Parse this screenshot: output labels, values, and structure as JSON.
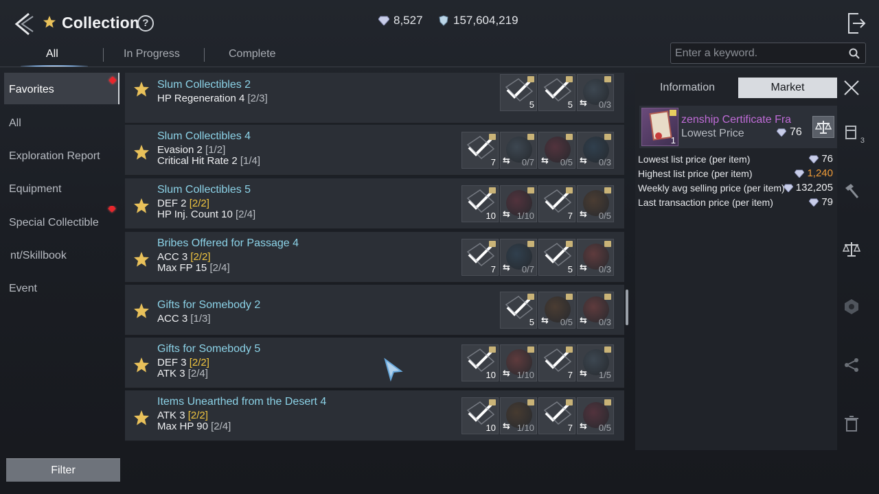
{
  "header": {
    "title": "Collection",
    "currencies": [
      {
        "icon": "diamond-icon",
        "value": "8,527"
      },
      {
        "icon": "shield-coin-icon",
        "value": "157,604,219"
      }
    ]
  },
  "tabs": [
    {
      "label": "All",
      "active": true
    },
    {
      "label": "In Progress",
      "active": false
    },
    {
      "label": "Complete",
      "active": false
    }
  ],
  "search": {
    "placeholder": "Enter a keyword."
  },
  "sidebar": {
    "items": [
      {
        "label": "Favorites",
        "active": true,
        "alert": true
      },
      {
        "label": "All",
        "active": false,
        "alert": false
      },
      {
        "label": "Exploration Report",
        "active": false,
        "alert": false
      },
      {
        "label": "Equipment",
        "active": false,
        "alert": false
      },
      {
        "label": "Special Collectible",
        "active": false,
        "alert": true
      },
      {
        "label": "nt/Skillbook",
        "active": false,
        "alert": false
      },
      {
        "label": "Event",
        "active": false,
        "alert": false
      }
    ],
    "filter_label": "Filter"
  },
  "collections": [
    {
      "name": "Slum Collectibles 2",
      "stats": [
        {
          "label": "HP Regeneration 4",
          "progress": "[2/3]",
          "complete": false
        }
      ],
      "slots": [
        {
          "type": "check",
          "qty": "5"
        },
        {
          "type": "check",
          "qty": "5"
        },
        {
          "type": "item",
          "progress": "0/3"
        }
      ]
    },
    {
      "name": "Slum Collectibles 4",
      "stats": [
        {
          "label": "Evasion 2",
          "progress": "[1/2]",
          "complete": false
        },
        {
          "label": "Critical Hit Rate 2",
          "progress": "[1/4]",
          "complete": false
        }
      ],
      "slots": [
        {
          "type": "check",
          "qty": "7"
        },
        {
          "type": "item",
          "progress": "0/7"
        },
        {
          "type": "item",
          "progress": "0/5"
        },
        {
          "type": "item",
          "progress": "0/3"
        }
      ]
    },
    {
      "name": "Slum Collectibles 5",
      "stats": [
        {
          "label": "DEF 2",
          "progress": "[2/2]",
          "complete": true
        },
        {
          "label": "HP Inj. Count 10",
          "progress": "[2/4]",
          "complete": false
        }
      ],
      "slots": [
        {
          "type": "check",
          "qty": "10"
        },
        {
          "type": "item",
          "progress": "1/10"
        },
        {
          "type": "check",
          "qty": "7"
        },
        {
          "type": "item",
          "progress": "0/5"
        }
      ]
    },
    {
      "name": "Bribes Offered for Passage 4",
      "stats": [
        {
          "label": "ACC 3",
          "progress": "[2/2]",
          "complete": true
        },
        {
          "label": "Max FP 15",
          "progress": "[2/4]",
          "complete": false
        }
      ],
      "slots": [
        {
          "type": "check",
          "qty": "7"
        },
        {
          "type": "item",
          "progress": "0/7"
        },
        {
          "type": "check",
          "qty": "5"
        },
        {
          "type": "item",
          "progress": "0/3"
        }
      ]
    },
    {
      "name": "Gifts for Somebody 2",
      "stats": [
        {
          "label": "ACC 3",
          "progress": "[1/3]",
          "complete": false
        }
      ],
      "slots": [
        {
          "type": "check",
          "qty": "5"
        },
        {
          "type": "item",
          "progress": "0/5"
        },
        {
          "type": "item",
          "progress": "0/3"
        }
      ]
    },
    {
      "name": "Gifts for Somebody 5",
      "stats": [
        {
          "label": "DEF 3",
          "progress": "[2/2]",
          "complete": true
        },
        {
          "label": "ATK 3",
          "progress": "[2/4]",
          "complete": false
        }
      ],
      "slots": [
        {
          "type": "check",
          "qty": "10"
        },
        {
          "type": "item",
          "progress": "1/10"
        },
        {
          "type": "check",
          "qty": "7"
        },
        {
          "type": "item",
          "progress": "1/5"
        }
      ]
    },
    {
      "name": "Items Unearthed from the Desert 4",
      "stats": [
        {
          "label": "ATK 3",
          "progress": "[2/2]",
          "complete": true
        },
        {
          "label": "Max HP 90",
          "progress": "[2/4]",
          "complete": false
        }
      ],
      "slots": [
        {
          "type": "check",
          "qty": "10"
        },
        {
          "type": "item",
          "progress": "1/10"
        },
        {
          "type": "check",
          "qty": "7"
        },
        {
          "type": "item",
          "progress": "0/5"
        }
      ]
    }
  ],
  "panel": {
    "tabs": [
      {
        "label": "Information",
        "active": false
      },
      {
        "label": "Market",
        "active": true
      }
    ],
    "item": {
      "name": "zenship Certificate Fra",
      "qty": "1",
      "lowest_label": "Lowest Price",
      "lowest_value": "76"
    },
    "prices": [
      {
        "label": "Lowest list price (per item)",
        "value": "76",
        "highlight": false
      },
      {
        "label": "Highest list price (per item)",
        "value": "1,240",
        "highlight": true
      },
      {
        "label": "Weekly avg selling price (per item)",
        "value": "132,205",
        "highlight": false
      },
      {
        "label": "Last transaction price (per item)",
        "value": "79",
        "highlight": false
      }
    ],
    "side_tools": [
      {
        "icon": "storage-icon",
        "badge": "3"
      },
      {
        "icon": "hammer-icon",
        "badge": ""
      },
      {
        "icon": "scale-icon",
        "badge": ""
      },
      {
        "icon": "hexagon-icon",
        "badge": ""
      },
      {
        "icon": "share-icon",
        "badge": ""
      },
      {
        "icon": "trash-icon",
        "badge": ""
      }
    ]
  },
  "colors": {
    "accent": "#8cd3e8",
    "complete": "#f2c640",
    "highlight": "#f09c38",
    "market_item": "#c06cd8",
    "alert": "#e8262c"
  }
}
